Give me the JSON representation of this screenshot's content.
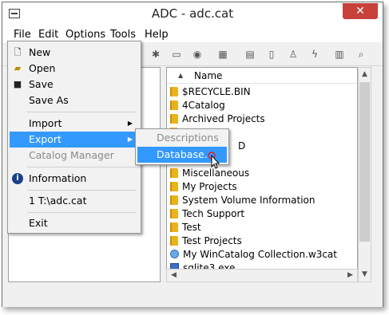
{
  "window": {
    "title": "ADC - adc.cat",
    "close_glyph": "✕"
  },
  "menubar": {
    "items": [
      "File",
      "Edit",
      "Options",
      "Tools",
      "Help"
    ]
  },
  "file_menu": {
    "items": [
      {
        "label": "New",
        "icon": "new-file-icon"
      },
      {
        "label": "Open",
        "icon": "open-folder-icon"
      },
      {
        "label": "Save",
        "icon": "save-disk-icon"
      },
      {
        "label": "Save As"
      },
      {
        "label": "Import"
      },
      {
        "label": "Export"
      },
      {
        "label": "Catalog Manager"
      },
      {
        "label": "Information",
        "icon": "info-icon"
      },
      {
        "label": "1 T:\\adc.cat"
      },
      {
        "label": "Exit"
      }
    ]
  },
  "export_submenu": {
    "items": [
      {
        "label": "Descriptions"
      },
      {
        "label": "Database..."
      }
    ]
  },
  "file_list": {
    "header": "Name",
    "rows": [
      "$RECYCLE.BIN",
      "4Catalog",
      "Archived Projects",
      "",
      "D",
      "",
      "Miscellaneous",
      "My Projects",
      "System Volume Information",
      "Tech Support",
      "Test",
      "Test Projects",
      "My WinCatalog Collection.w3cat",
      "sqlite3.exe"
    ]
  },
  "colors": {
    "highlight": "#3399ff",
    "folder": "#e9b31c",
    "close": "#c7403a"
  }
}
